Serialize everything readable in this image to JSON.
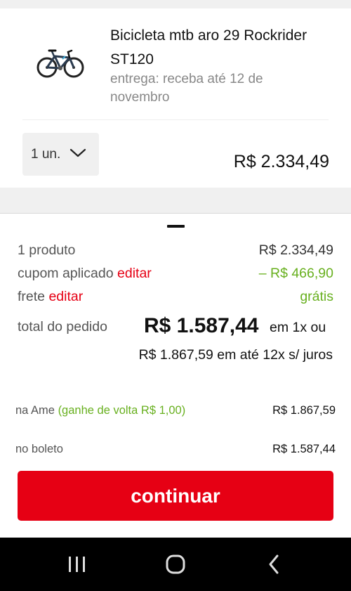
{
  "product": {
    "name": "Bicicleta mtb aro 29 Rockrider ST120",
    "delivery": "entrega: receba até 12 de novembro",
    "image_icon": "mountain-bike-image",
    "quantity": "1 un.",
    "price": "R$ 2.334,49"
  },
  "summary": {
    "products_label": "1 produto",
    "products_value": "R$ 2.334,49",
    "coupon_label": "cupom aplicado",
    "coupon_edit": "editar",
    "coupon_value": "– R$ 466,90",
    "shipping_label": "frete",
    "shipping_edit": "editar",
    "shipping_value": "grátis",
    "total_label": "total do pedido",
    "total_value": "R$ 1.587,44",
    "total_suffix": "em 1x ou",
    "installments": "R$ 1.867,59 em até 12x s/ juros"
  },
  "payment_options": {
    "ame_label": "na Ame",
    "ame_cashback": "(ganhe de volta R$ 1,00)",
    "ame_value": "R$ 1.867,59",
    "boleto_label": "no boleto",
    "boleto_value": "R$ 1.587,44"
  },
  "actions": {
    "continue_label": "continuar"
  },
  "colors": {
    "accent": "#e60014",
    "positive": "#68b01f",
    "background_gray": "#f0f0f0"
  },
  "nav": {
    "recents_icon": "recent-apps-icon",
    "home_icon": "home-icon",
    "back_icon": "back-icon"
  }
}
